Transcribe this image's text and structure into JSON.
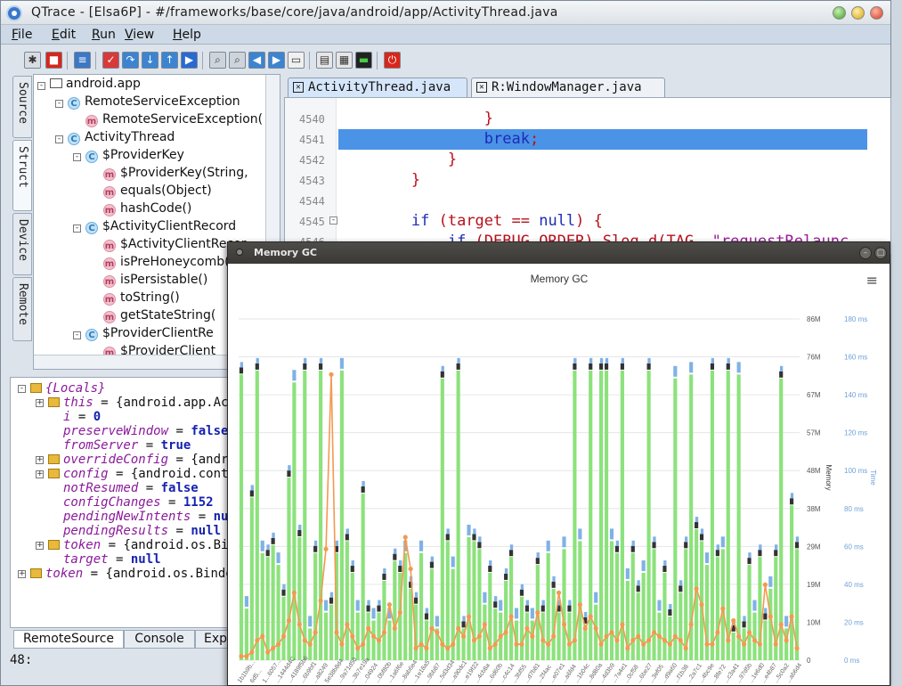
{
  "window": {
    "title": "QTrace - [Elsa6P] - #/frameworks/base/core/java/android/app/ActivityThread.java"
  },
  "menu": [
    {
      "label": "File"
    },
    {
      "label": "Edit"
    },
    {
      "label": "Run"
    },
    {
      "label": "View"
    },
    {
      "label": "Help"
    }
  ],
  "side_tabs": [
    {
      "label": "Source"
    },
    {
      "label": "Struct"
    },
    {
      "label": "Device"
    },
    {
      "label": "Remote"
    }
  ],
  "struct_tree": [
    {
      "label": "android.app",
      "kind": "package",
      "depth": 0,
      "toggle": "-"
    },
    {
      "label": "RemoteServiceException",
      "kind": "class",
      "depth": 1,
      "toggle": "-"
    },
    {
      "label": "RemoteServiceException(",
      "kind": "method",
      "depth": 2,
      "toggle": ""
    },
    {
      "label": "ActivityThread",
      "kind": "class",
      "depth": 1,
      "toggle": "-"
    },
    {
      "label": "$ProviderKey",
      "kind": "class",
      "depth": 2,
      "toggle": "-"
    },
    {
      "label": "$ProviderKey(String,",
      "kind": "method",
      "depth": 3,
      "toggle": ""
    },
    {
      "label": "equals(Object)",
      "kind": "method",
      "depth": 3,
      "toggle": ""
    },
    {
      "label": "hashCode()",
      "kind": "method",
      "depth": 3,
      "toggle": ""
    },
    {
      "label": "$ActivityClientRecord",
      "kind": "class",
      "depth": 2,
      "toggle": "-"
    },
    {
      "label": "$ActivityClientRecor",
      "kind": "method",
      "depth": 3,
      "toggle": ""
    },
    {
      "label": "isPreHoneycomb(",
      "kind": "method",
      "depth": 3,
      "toggle": ""
    },
    {
      "label": "isPersistable()",
      "kind": "method",
      "depth": 3,
      "toggle": ""
    },
    {
      "label": "toString()",
      "kind": "method",
      "depth": 3,
      "toggle": ""
    },
    {
      "label": "getStateString(",
      "kind": "method",
      "depth": 3,
      "toggle": ""
    },
    {
      "label": "$ProviderClientRe",
      "kind": "class",
      "depth": 2,
      "toggle": "-"
    },
    {
      "label": "$ProviderClient",
      "kind": "method",
      "depth": 3,
      "toggle": ""
    }
  ],
  "locals": [
    {
      "pre": "",
      "name": "{Locals}",
      "op": "",
      "value": "",
      "vtype": "plain",
      "depth": 0,
      "folder": true,
      "toggle": "-"
    },
    {
      "pre": "",
      "name": "this",
      "op": " = ",
      "value": "{android.app.Act",
      "vtype": "plain",
      "depth": 1,
      "folder": true,
      "toggle": "+"
    },
    {
      "pre": "",
      "name": "i",
      "op": " = ",
      "value": "0",
      "vtype": "kw",
      "depth": 1,
      "folder": false,
      "toggle": ""
    },
    {
      "pre": "",
      "name": "preserveWindow",
      "op": " = ",
      "value": "false",
      "vtype": "kw",
      "depth": 1,
      "folder": false,
      "toggle": ""
    },
    {
      "pre": "",
      "name": "fromServer",
      "op": " = ",
      "value": "true",
      "vtype": "kw",
      "depth": 1,
      "folder": false,
      "toggle": ""
    },
    {
      "pre": "",
      "name": "overrideConfig",
      "op": " = ",
      "value": "{andro",
      "vtype": "plain",
      "depth": 1,
      "folder": true,
      "toggle": "+"
    },
    {
      "pre": "",
      "name": "config",
      "op": " = ",
      "value": "{android.conte",
      "vtype": "plain",
      "depth": 1,
      "folder": true,
      "toggle": "+"
    },
    {
      "pre": "",
      "name": "notResumed",
      "op": " = ",
      "value": "false",
      "vtype": "kw",
      "depth": 1,
      "folder": false,
      "toggle": ""
    },
    {
      "pre": "",
      "name": "configChanges",
      "op": " = ",
      "value": "1152",
      "vtype": "kw",
      "depth": 1,
      "folder": false,
      "toggle": ""
    },
    {
      "pre": "",
      "name": "pendingNewIntents",
      "op": " = ",
      "value": "nul",
      "vtype": "kw",
      "depth": 1,
      "folder": false,
      "toggle": ""
    },
    {
      "pre": "",
      "name": "pendingResults",
      "op": " = ",
      "value": "null",
      "vtype": "kw",
      "depth": 1,
      "folder": false,
      "toggle": ""
    },
    {
      "pre": "",
      "name": "token",
      "op": " = ",
      "value": "{android.os.Bin",
      "vtype": "plain",
      "depth": 1,
      "folder": true,
      "toggle": "+"
    },
    {
      "pre": "",
      "name": "target",
      "op": " = ",
      "value": "null",
      "vtype": "kw",
      "depth": 1,
      "folder": false,
      "toggle": ""
    },
    {
      "pre": "",
      "name": "token",
      "op": " = ",
      "value": "{android.os.Binde",
      "vtype": "plain",
      "depth": 0,
      "folder": true,
      "toggle": "+"
    }
  ],
  "bottom_tabs": [
    {
      "label": "RemoteSource"
    },
    {
      "label": "Console"
    },
    {
      "label": "Exp"
    }
  ],
  "status": {
    "text": "48:"
  },
  "editor": {
    "tabs": [
      {
        "label": "ActivityThread.java"
      },
      {
        "label": "R:WindowManager.java"
      }
    ],
    "lines": [
      {
        "num": "4540",
        "text": "                }",
        "selected": false
      },
      {
        "num": "4541",
        "text": "                break;",
        "selected": true
      },
      {
        "num": "4542",
        "text": "            }",
        "selected": false
      },
      {
        "num": "4543",
        "text": "        }",
        "selected": false
      },
      {
        "num": "4544",
        "text": "",
        "selected": false
      },
      {
        "num": "4545",
        "text": "        if (target == null) {",
        "selected": false
      },
      {
        "num": "4546",
        "text": "            if (DEBUG_ORDER) Slog.d(TAG, \"requestRelaunc",
        "selected": false
      }
    ]
  },
  "gc_window": {
    "title": "Memory GC"
  },
  "chart_data": {
    "type": "bar",
    "title": "Memory GC",
    "ylabel": "Memory",
    "y2label": "Time",
    "y_ticks": [
      "0",
      "10M",
      "19M",
      "29M",
      "38M",
      "48M",
      "57M",
      "67M",
      "76M",
      "86M"
    ],
    "y2_ticks": [
      "0 ms",
      "20 ms",
      "40 ms",
      "60 ms",
      "80 ms",
      "100 ms",
      "120 ms",
      "140 ms",
      "160 ms",
      "180 ms"
    ],
    "ylim": [
      0,
      86
    ],
    "y2lim": [
      0,
      180
    ],
    "x_tick_labels": [
      "1b1b9b...",
      "6d5...",
      "1...6057...",
      "...1444d4C",
      "...4189f5b6",
      "...6b9bf1",
      "...a8249",
      "5e38b8d4",
      "...9a71d50",
      "...3b7e19a",
      "...04924",
      "...0bf80b",
      "...1a6f6e",
      "...8ab6e4",
      "...1e18a5",
      "...9bb87",
      "...5d3d34",
      "...a90dc1",
      "...e19f22",
      "...4cb8a",
      "...6d60b",
      "...c4c14",
      "...3bf55",
      "...d7b81",
      "...2f4ac",
      "...e07e1",
      "...a6fd4",
      "...1b04c",
      "...8d80a",
      "...4d3b9",
      "...7a4e1",
      "...0cf58",
      "...6be27",
      "...3ef05",
      "...d9a60",
      "...f1b38",
      "...2a7c1",
      "...4bc9e",
      "...8fe72",
      "...c3a41",
      "...97d5b",
      "...1e6d0",
      "...e4b87",
      "...5c0a2",
      "...ab6d4"
    ],
    "series": [
      {
        "name": "",
        "color": "#8ce27c",
        "values": [
          72,
          13,
          41,
          73,
          27,
          26,
          29,
          24,
          16,
          46,
          70,
          31,
          73,
          8,
          27,
          73,
          12,
          14,
          27,
          73,
          30,
          22,
          12,
          42,
          12,
          10,
          12,
          20,
          10,
          25,
          22,
          27,
          18,
          14,
          27,
          10,
          23,
          8,
          71,
          30,
          23,
          73,
          8,
          31,
          30,
          28,
          14,
          22,
          13,
          12,
          20,
          26,
          10,
          16,
          12,
          10,
          24,
          12,
          27,
          18,
          12,
          28,
          12,
          73,
          30,
          9,
          73,
          14,
          73,
          73,
          30,
          27,
          73,
          20,
          27,
          17,
          22,
          73,
          28,
          12,
          22,
          11,
          71,
          17,
          28,
          72,
          33,
          30,
          24,
          73,
          26,
          28,
          73,
          7,
          72,
          8,
          24,
          12,
          26,
          10,
          18,
          26,
          71,
          8,
          39,
          28
        ]
      },
      {
        "name": "",
        "color": "#f39a50",
        "values": [
          1,
          1,
          2,
          5,
          6,
          2,
          3,
          4,
          6,
          10,
          17,
          9,
          5,
          4,
          7,
          15,
          28,
          72,
          7,
          4,
          9,
          6,
          3,
          4,
          8,
          6,
          5,
          7,
          14,
          8,
          12,
          31,
          23,
          3,
          4,
          3,
          8,
          7,
          4,
          3,
          4,
          8,
          6,
          11,
          5,
          6,
          9,
          3,
          4,
          6,
          7,
          11,
          4,
          4,
          8,
          6,
          12,
          5,
          4,
          6,
          17,
          9,
          4,
          5,
          14,
          8,
          11,
          8,
          4,
          6,
          7,
          5,
          9,
          3,
          5,
          6,
          4,
          5,
          7,
          6,
          5,
          4,
          6,
          5,
          3,
          9,
          18,
          14,
          4,
          4,
          7,
          13,
          5,
          10,
          6,
          4,
          7,
          5,
          4,
          19,
          11,
          4,
          9,
          5,
          11,
          3
        ]
      }
    ],
    "legend": "none",
    "grid": true
  }
}
